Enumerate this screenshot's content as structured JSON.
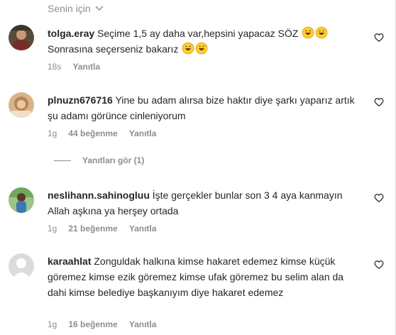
{
  "header": {
    "title": "Senin için"
  },
  "comments": [
    {
      "username": "tolga.eray",
      "text": "Seçime 1,5 ay daha var,hepsini yapacaz SÖZ",
      "text2": "Sonrasına seçerseniz bakarız",
      "time": "18s",
      "reply": "Yanıtla"
    },
    {
      "username": "plnuzn676716",
      "text": "Yine bu adam alırsa bize haktır diye şarkı yaparız artık şu adamı görünce cinleniyorum",
      "time": "1g",
      "likes": "44 beğenme",
      "reply": "Yanıtla",
      "view_replies": "Yanıtları gör (1)"
    },
    {
      "username": "neslihann.sahinogluu",
      "text": "İşte gerçekler bunlar son 3 4 aya kanmayın Allah aşkına ya herşey ortada",
      "time": "1g",
      "likes": "21 beğenme",
      "reply": "Yanıtla"
    },
    {
      "username": "karaahlat",
      "text": "Zonguldak halkına kimse hakaret edemez kimse küçük göremez kimse ezik göremez kimse ufak göremez bu selim alan da dahi kimse belediye başkanıyım diye hakaret edemez",
      "time": "1g",
      "likes": "16 beğenme",
      "reply": "Yanıtla"
    }
  ],
  "icons": {
    "heart": "heart-outline-icon",
    "chevron": "chevron-down-icon",
    "emoji": "grinning-sweat-emoji"
  },
  "colors": {
    "text": "#262626",
    "muted": "#8e8e8e",
    "background": "#ffffff"
  }
}
